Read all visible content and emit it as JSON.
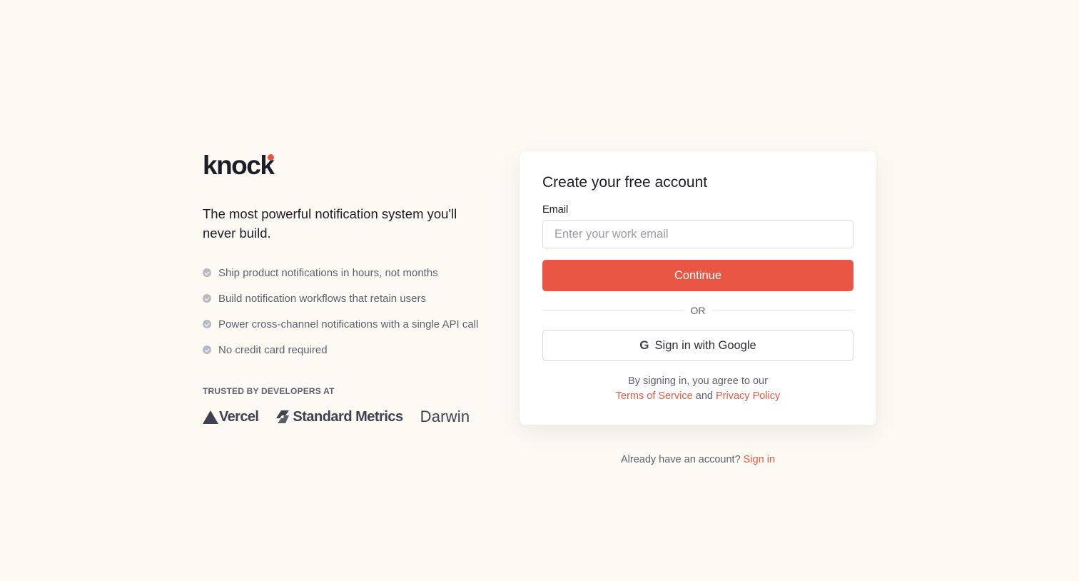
{
  "brand": {
    "logo_text": "knock",
    "accent_color": "#e95744"
  },
  "hero": {
    "tagline": "The most powerful notification system you'll never build.",
    "features": [
      "Ship product notifications in hours, not months",
      "Build notification workflows that retain users",
      "Power cross-channel notifications with a single API call",
      "No credit card required"
    ],
    "trusted_label": "TRUSTED BY DEVELOPERS AT",
    "customers": [
      "Vercel",
      "Standard Metrics",
      "Darwin"
    ]
  },
  "signup": {
    "title": "Create your free account",
    "email_label": "Email",
    "email_value": "",
    "email_placeholder": "Enter your work email",
    "continue_label": "Continue",
    "divider_label": "OR",
    "google_label": "Sign in with Google",
    "google_icon": "google-g-icon",
    "legal_prefix": "By signing in, you agree to our",
    "terms_label": "Terms of Service",
    "legal_and": "and",
    "privacy_label": "Privacy Policy"
  },
  "footer": {
    "already_text": "Already have an account?",
    "signin_label": "Sign in"
  }
}
